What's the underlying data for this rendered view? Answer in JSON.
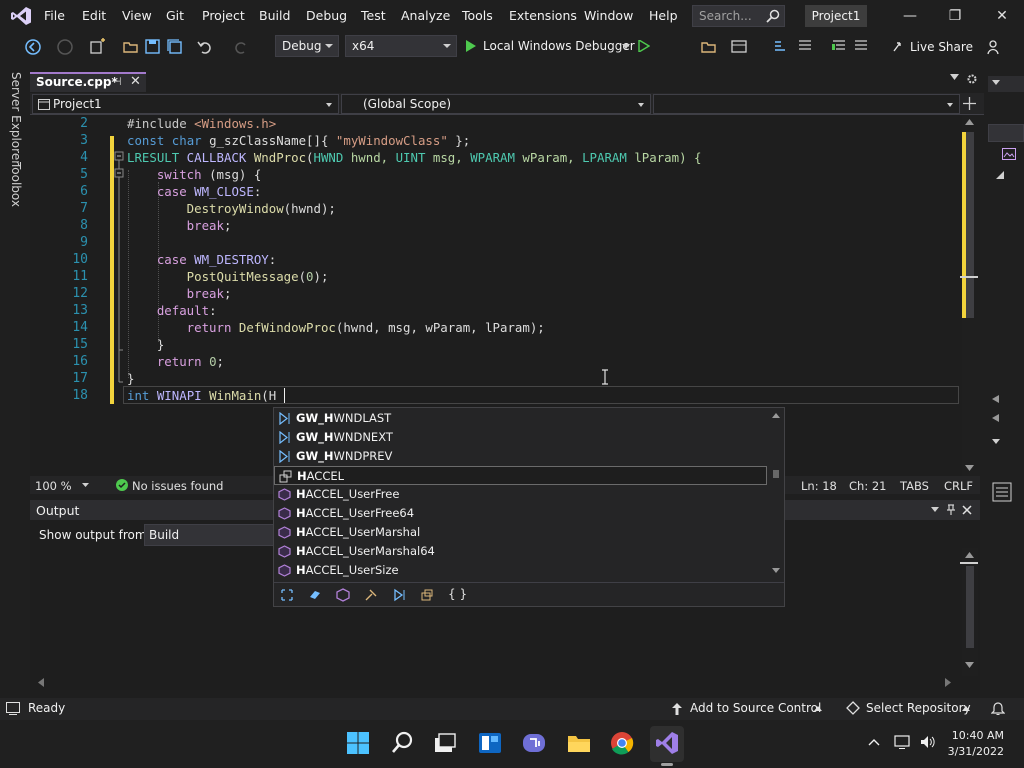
{
  "menu": [
    "File",
    "Edit",
    "View",
    "Git",
    "Project",
    "Build",
    "Debug",
    "Test",
    "Analyze",
    "Tools",
    "Extensions",
    "Window",
    "Help"
  ],
  "search": {
    "placeholder": "Search..."
  },
  "project_badge": "Project1",
  "toolbar": {
    "config": "Debug",
    "platform": "x64",
    "run_target": "Local Windows Debugger",
    "live_share": "Live Share"
  },
  "left_tabs": [
    "Server Explorer",
    "Toolbox"
  ],
  "doc_tab": {
    "label": "Source.cpp*",
    "pin": "⊣",
    "close": "✕"
  },
  "navbar": {
    "project": "Project1",
    "scope": "(Global Scope)",
    "member": ""
  },
  "code_lines": [
    {
      "n": "2"
    },
    {
      "n": "3"
    },
    {
      "n": "4"
    },
    {
      "n": "5"
    },
    {
      "n": "6"
    },
    {
      "n": "7"
    },
    {
      "n": "8"
    },
    {
      "n": "9"
    },
    {
      "n": "10"
    },
    {
      "n": "11"
    },
    {
      "n": "12"
    },
    {
      "n": "13"
    },
    {
      "n": "14"
    },
    {
      "n": "15"
    },
    {
      "n": "16"
    },
    {
      "n": "17"
    },
    {
      "n": "18"
    }
  ],
  "code": {
    "l2_a": "#include ",
    "l2_b": "<Windows.h>",
    "l3_a": "const",
    "l3_b": " char",
    "l3_c": " g_szClassName[]{ ",
    "l3_d": "\"myWindowClass\"",
    "l3_e": " };",
    "l4_a": "LRESULT",
    "l4_b": " CALLBACK",
    "l4_c": " WndProc",
    "l4_d": "(",
    "l4_e": "HWND",
    "l4_f": " hwnd, ",
    "l4_g": "UINT",
    "l4_h": " msg, ",
    "l4_i": "WPARAM",
    "l4_j": " wParam, ",
    "l4_k": "LPARAM",
    "l4_l": " lParam) {",
    "l5_a": "    switch",
    "l5_b": " (msg) {",
    "l6_a": "    case",
    "l6_b": " WM_CLOSE",
    "l6_c": ":",
    "l7_a": "        DestroyWindow",
    "l7_b": "(hwnd);",
    "l8_a": "        break",
    "l8_b": ";",
    "l10_a": "    case",
    "l10_b": " WM_DESTROY",
    "l10_c": ":",
    "l11_a": "        PostQuitMessage",
    "l11_b": "(",
    "l11_c": "0",
    "l11_d": ");",
    "l12_a": "        break",
    "l12_b": ";",
    "l13_a": "    default",
    "l13_b": ":",
    "l14_a": "        return",
    "l14_b": " DefWindowProc",
    "l14_c": "(hwnd, msg, wParam, lParam);",
    "l15_a": "    }",
    "l16_a": "    return",
    "l16_b": " ",
    "l16_c": "0",
    "l16_d": ";",
    "l17_a": "}",
    "l18_a": "int",
    "l18_b": " WINAPI",
    "l18_c": " WinMain",
    "l18_d": "(H"
  },
  "completion": [
    {
      "bold": "GW_H",
      "rest": "WNDLAST",
      "icon": "enum-member-icon"
    },
    {
      "bold": "GW_H",
      "rest": "WNDNEXT",
      "icon": "enum-member-icon"
    },
    {
      "bold": "GW_H",
      "rest": "WNDPREV",
      "icon": "enum-member-icon"
    },
    {
      "bold": "H",
      "rest": "ACCEL",
      "icon": "typedef-icon"
    },
    {
      "bold": "H",
      "rest": "ACCEL_UserFree",
      "icon": "function-icon"
    },
    {
      "bold": "H",
      "rest": "ACCEL_UserFree64",
      "icon": "function-icon"
    },
    {
      "bold": "H",
      "rest": "ACCEL_UserMarshal",
      "icon": "function-icon"
    },
    {
      "bold": "H",
      "rest": "ACCEL_UserMarshal64",
      "icon": "function-icon"
    },
    {
      "bold": "H",
      "rest": "ACCEL_UserSize",
      "icon": "function-icon"
    }
  ],
  "popup_filter_braces": "{ }",
  "editor_status": {
    "zoom": "100 %",
    "issues": "No issues found",
    "line": "Ln: 18",
    "col": "Ch: 21",
    "tabs": "TABS",
    "eol": "CRLF"
  },
  "output": {
    "title": "Output",
    "show_from_label": "Show output from:",
    "source": "Build"
  },
  "statusbar": {
    "ready": "Ready",
    "source_control": "Add to Source Control",
    "repo": "Select Repository"
  },
  "tray": {
    "time": "10:40 AM",
    "date": "3/31/2022"
  },
  "colors": {
    "accent": "#a37acc",
    "keyword": "#569cd6",
    "type": "#4ec9b0",
    "function": "#dcdcaa",
    "string": "#d69d85",
    "line_number": "#2b91af",
    "change_bar": "#f2d33c"
  }
}
